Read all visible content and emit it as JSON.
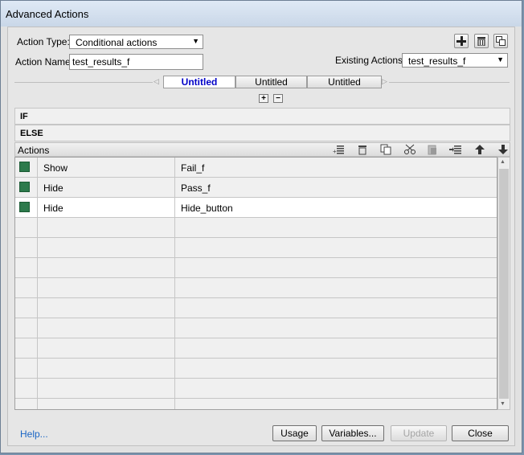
{
  "window": {
    "title": "Advanced Actions"
  },
  "form": {
    "action_type_label": "Action Type:",
    "action_type_value": "Conditional actions",
    "action_name_label": "Action Name:",
    "action_name_value": "test_results_f",
    "existing_label": "Existing Actions:",
    "existing_value": "test_results_f"
  },
  "toolbar": {
    "add_icon": "plus-icon",
    "delete_icon": "trash-icon",
    "duplicate_icon": "duplicate-icon"
  },
  "tabs": [
    {
      "label": "Untitled",
      "active": true
    },
    {
      "label": "Untitled",
      "active": false
    },
    {
      "label": "Untitled",
      "active": false
    }
  ],
  "sections": {
    "if_label": "IF",
    "else_label": "ELSE"
  },
  "actions": {
    "header": "Actions",
    "icons": [
      "add-row-icon",
      "delete-icon",
      "copy-icon",
      "cut-icon",
      "paste-icon",
      "insert-icon",
      "move-up-icon",
      "move-down-icon"
    ],
    "rows": [
      {
        "action": "Show",
        "target": "Fail_f",
        "color": "#2d7a4c"
      },
      {
        "action": "Hide",
        "target": "Pass_f",
        "color": "#2d7a4c"
      },
      {
        "action": "Hide",
        "target": "Hide_button",
        "color": "#2d7a4c"
      }
    ]
  },
  "footer": {
    "help": "Help...",
    "usage": "Usage",
    "variables": "Variables...",
    "update": "Update",
    "close": "Close"
  }
}
